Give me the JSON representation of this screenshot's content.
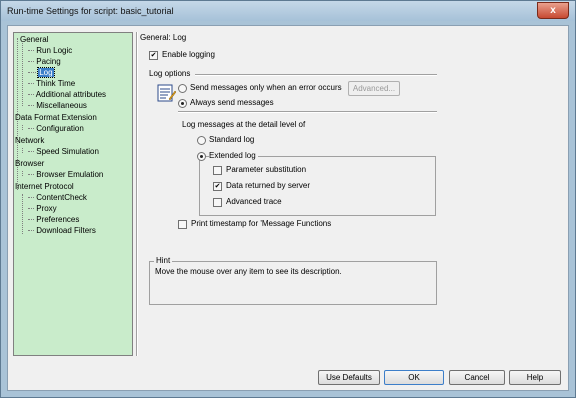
{
  "window": {
    "title": "Run-time Settings for script: basic_tutorial",
    "close_glyph": "x"
  },
  "tree": {
    "items": [
      {
        "label": "General",
        "level": 0
      },
      {
        "label": "Run Logic",
        "level": 1
      },
      {
        "label": "Pacing",
        "level": 1
      },
      {
        "label": "Log",
        "level": 1,
        "selected": true
      },
      {
        "label": "Think Time",
        "level": 1
      },
      {
        "label": "Additional attributes",
        "level": 1
      },
      {
        "label": "Miscellaneous",
        "level": 1
      },
      {
        "label": "Data Format Extension",
        "level": 0
      },
      {
        "label": "Configuration",
        "level": 1
      },
      {
        "label": "Network",
        "level": 0
      },
      {
        "label": "Speed Simulation",
        "level": 1
      },
      {
        "label": "Browser",
        "level": 0
      },
      {
        "label": "Browser Emulation",
        "level": 1
      },
      {
        "label": "Internet Protocol",
        "level": 0
      },
      {
        "label": "ContentCheck",
        "level": 1
      },
      {
        "label": "Proxy",
        "level": 1
      },
      {
        "label": "Preferences",
        "level": 1
      },
      {
        "label": "Download Filters",
        "level": 1
      }
    ]
  },
  "panel": {
    "section_title": "General: Log",
    "enable_logging": {
      "label": "Enable logging",
      "checked": true
    },
    "log_options": {
      "title": "Log options",
      "send_on_error": {
        "label": "Send messages only when an error occurs",
        "selected": false
      },
      "advanced_button": "Advanced...",
      "always_send": {
        "label": "Always send messages",
        "selected": true
      }
    },
    "detail": {
      "title": "Log messages at the detail level of",
      "standard": {
        "label": "Standard log",
        "selected": false
      },
      "extended": {
        "label": "Extended log",
        "selected": true
      },
      "param_sub": {
        "label": "Parameter substitution",
        "checked": false
      },
      "data_returned": {
        "label": "Data returned by server",
        "checked": true
      },
      "advanced_trace": {
        "label": "Advanced trace",
        "checked": false
      }
    },
    "timestamp": {
      "label": "Print timestamp for 'Message Functions",
      "checked": false
    },
    "hint": {
      "title": "Hint",
      "text": "Move the mouse over any item to see its description."
    }
  },
  "buttons": {
    "use_defaults": "Use Defaults",
    "ok": "OK",
    "cancel": "Cancel",
    "help": "Help"
  },
  "check_glyph": "✔",
  "colors": {
    "tree_bg": "#c9eccb",
    "selection": "#3c7ec9",
    "titlebar": "#a6c1d8",
    "close": "#c74a32"
  }
}
